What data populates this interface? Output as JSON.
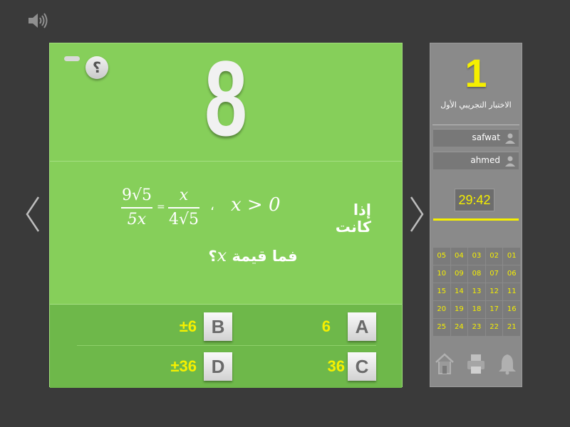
{
  "question": {
    "number": "8",
    "help_label": "؟",
    "frac_left": {
      "num": "9√5",
      "den": "5x"
    },
    "equals": "=",
    "frac_right": {
      "num": "x",
      "den": "4√5"
    },
    "comma": "،",
    "condition": "x > 0",
    "if_text": "إذا كانت",
    "ask_prefix": "فما قيمة",
    "ask_var": "x",
    "ask_mark": "؟"
  },
  "answers": [
    {
      "letter": "A",
      "value": "6"
    },
    {
      "letter": "B",
      "value": "±6"
    },
    {
      "letter": "C",
      "value": "36"
    },
    {
      "letter": "D",
      "value": "±36"
    }
  ],
  "panel": {
    "test_number": "1",
    "test_title": "الاختبار التجريبي الأول",
    "players": [
      {
        "name": "safwat"
      },
      {
        "name": "ahmed"
      }
    ],
    "timer": "29:42",
    "timer_progress": 1.0,
    "question_grid": [
      [
        "05",
        "04",
        "03",
        "02",
        "01"
      ],
      [
        "10",
        "09",
        "08",
        "07",
        "06"
      ],
      [
        "15",
        "14",
        "13",
        "12",
        "11"
      ],
      [
        "20",
        "19",
        "18",
        "17",
        "16"
      ],
      [
        "25",
        "24",
        "23",
        "22",
        "21"
      ]
    ]
  },
  "colors": {
    "card_green": "#86cf5a",
    "answers_green": "#6eb84a",
    "accent_yellow": "#f5ef00",
    "panel_gray": "#8a8a8a",
    "background": "#3a3a3a"
  },
  "icons": {
    "sound": "speaker-icon",
    "prev": "chevron-left-icon",
    "next": "chevron-right-icon",
    "home": "home-icon",
    "print": "printer-icon",
    "bell": "bell-icon",
    "user": "user-icon"
  }
}
